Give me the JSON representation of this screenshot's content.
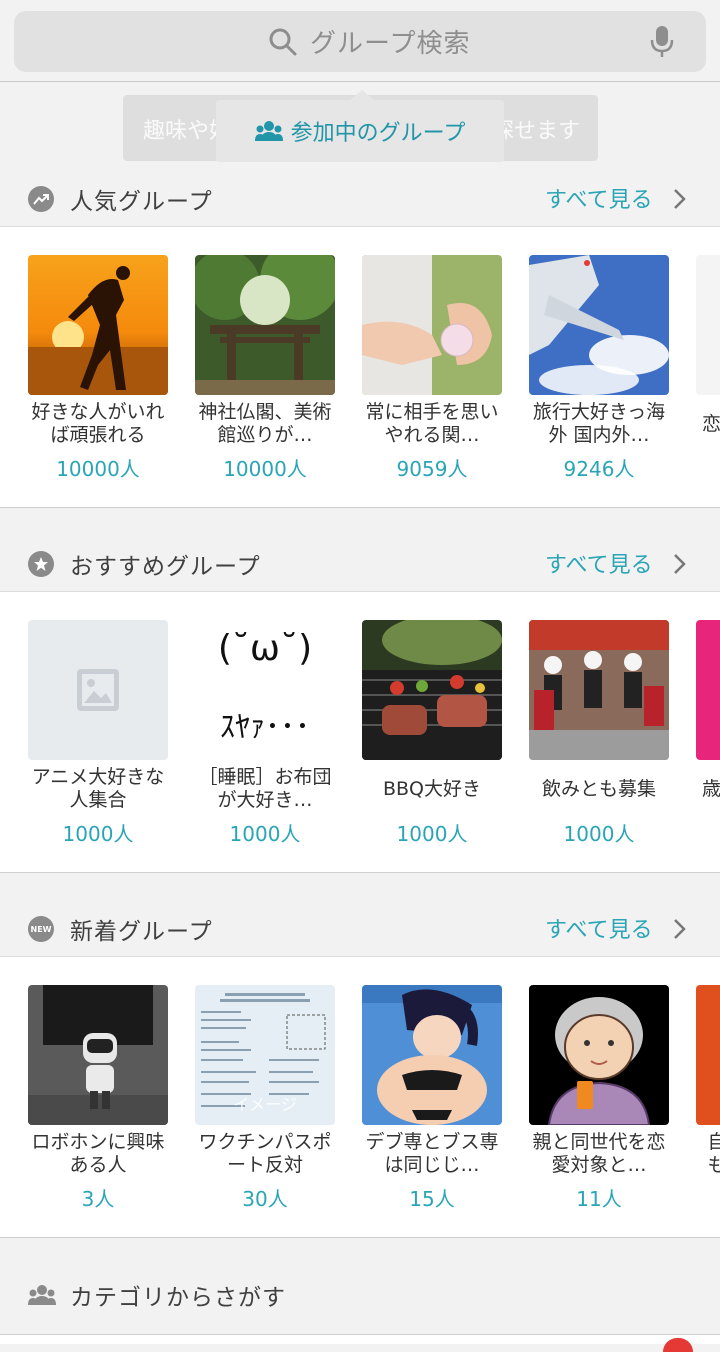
{
  "search": {
    "placeholder": "グループ検索"
  },
  "tooltip": {
    "label": "参加中のグループ",
    "ghost_left": "趣味や好",
    "ghost_right": "と探せます"
  },
  "sections": [
    {
      "title": "人気グループ",
      "icon": "trending-icon",
      "see_all": "すべて見る",
      "cards": [
        {
          "name": "好きな人がいれば頑張れる",
          "count": "10000人"
        },
        {
          "name": "神社仏閣、美術館巡りが…",
          "count": "10000人"
        },
        {
          "name": "常に相手を思いやれる関…",
          "count": "9059人"
        },
        {
          "name": "旅行大好きっ海外 国内外…",
          "count": "9246人"
        },
        {
          "name": "恋",
          "count": ""
        }
      ]
    },
    {
      "title": "おすすめグループ",
      "icon": "star-icon",
      "see_all": "すべて見る",
      "cards": [
        {
          "name": "アニメ大好きな人集合",
          "count": "1000人"
        },
        {
          "name": "［睡眠］お布団が大好き…",
          "count": "1000人",
          "thumb_text_top": "(˘ω˘)",
          "thumb_text_bottom": "ｽﾔｧ･･･"
        },
        {
          "name": "BBQ大好き",
          "count": "1000人"
        },
        {
          "name": "飲みとも募集",
          "count": "1000人"
        },
        {
          "name": "歳",
          "count": ""
        }
      ]
    },
    {
      "title": "新着グループ",
      "icon": "new-icon",
      "icon_text": "NEW",
      "see_all": "すべて見る",
      "cards": [
        {
          "name": "ロボホンに興味ある人",
          "count": "3人"
        },
        {
          "name": "ワクチンパスポート反対",
          "count": "30人"
        },
        {
          "name": "デブ専とブス専は同じじ…",
          "count": "15人"
        },
        {
          "name": "親と同世代を恋愛対象と…",
          "count": "11人"
        },
        {
          "name": "自も",
          "count": ""
        }
      ]
    }
  ],
  "category": {
    "title": "カテゴリからさがす"
  },
  "colors": {
    "accent": "#2aa5b6",
    "tooltip_text": "#2196a8",
    "background": "#f2f2f2"
  }
}
